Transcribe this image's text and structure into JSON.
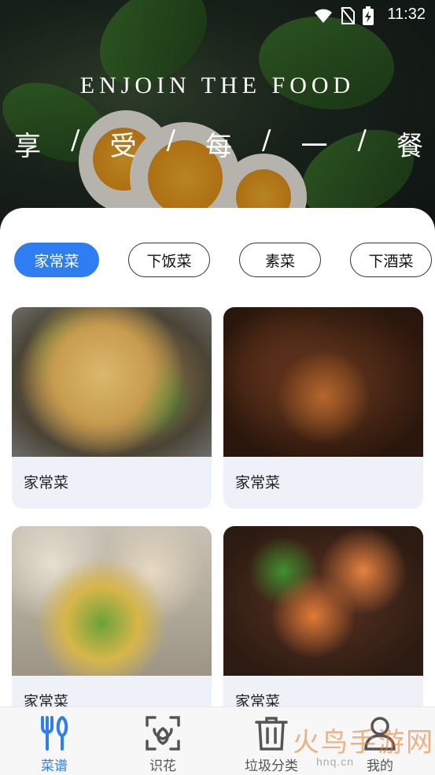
{
  "status": {
    "time": "11:32"
  },
  "hero": {
    "title": "ENJOIN THE FOOD",
    "subtitle_chars": [
      "享",
      "/",
      "受",
      "/",
      "每",
      "/",
      "一",
      "/",
      "餐"
    ]
  },
  "chips": [
    {
      "label": "家常菜",
      "active": true
    },
    {
      "label": "下饭菜",
      "active": false
    },
    {
      "label": "素菜",
      "active": false
    },
    {
      "label": "下酒菜",
      "active": false
    }
  ],
  "cards": [
    {
      "label": "家常菜"
    },
    {
      "label": "家常菜"
    },
    {
      "label": "家常菜"
    },
    {
      "label": "家常菜"
    }
  ],
  "tabs": [
    {
      "label": "菜谱",
      "icon": "fork-knife-icon",
      "active": true
    },
    {
      "label": "识花",
      "icon": "scan-flower-icon",
      "active": false
    },
    {
      "label": "垃圾分类",
      "icon": "trash-icon",
      "active": false
    },
    {
      "label": "我的",
      "icon": "user-icon",
      "active": false
    }
  ],
  "watermark": {
    "text": "火鸟手游网",
    "url": "hnq.cn"
  },
  "colors": {
    "accent": "#2f7ef1"
  }
}
